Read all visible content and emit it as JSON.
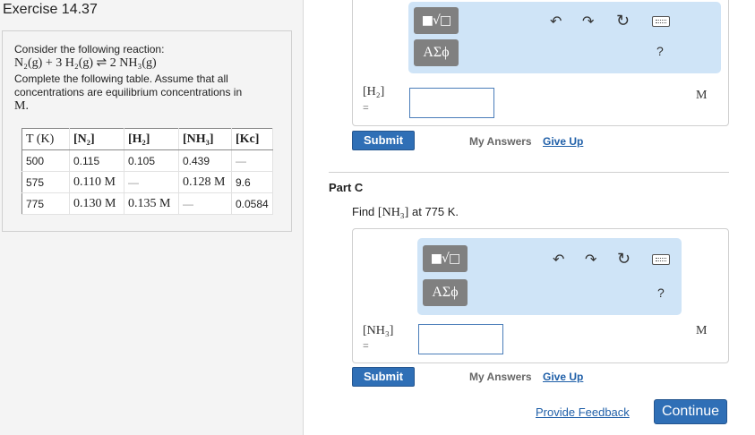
{
  "exercise": {
    "title": "Exercise 14.37"
  },
  "problem": {
    "line1": "Consider the following reaction:",
    "equation": "N₂(g) + 3 H₂(g) ⇌ 2 NH₃(g)",
    "line2": "Complete the following table. Assume that all",
    "line3": "concentrations are equilibrium concentrations in",
    "line4": "M."
  },
  "table": {
    "headers": [
      "T (K)",
      "[N₂]",
      "[H₂]",
      "[NH₃]",
      "[Kc]"
    ],
    "rows": [
      [
        "500",
        "0.115",
        "0.105",
        "0.439",
        "—"
      ],
      [
        "575",
        "0.110 M",
        "—",
        "0.128 M",
        "9.6"
      ],
      [
        "775",
        "0.130 M",
        "0.135 M",
        "—",
        "0.0584"
      ]
    ]
  },
  "part_b": {
    "tool_radical": "■√□",
    "tool_greek": "ΑΣϕ",
    "variable": "[H₂]",
    "equals": "=",
    "input_value": "",
    "unit": "M",
    "help": "?",
    "submit": "Submit",
    "my_answers": "My Answers",
    "give_up": "Give Up"
  },
  "part_c": {
    "label": "Part C",
    "question_prefix": "Find",
    "question_var": "[NH₃]",
    "question_suffix": "at 775 K.",
    "tool_radical": "■√□",
    "tool_greek": "ΑΣϕ",
    "variable": "[NH₃]",
    "equals": "=",
    "input_value": "",
    "unit": "M",
    "help": "?",
    "submit": "Submit",
    "my_answers": "My Answers",
    "give_up": "Give Up"
  },
  "footer": {
    "feedback": "Provide Feedback",
    "continue": "Continue"
  },
  "icons": {
    "undo": "↶",
    "redo": "↷",
    "reset": "↻"
  },
  "colors": {
    "toolbar": "#cfe4f7",
    "button": "#2f6fb6",
    "link": "#1f5fa8"
  }
}
